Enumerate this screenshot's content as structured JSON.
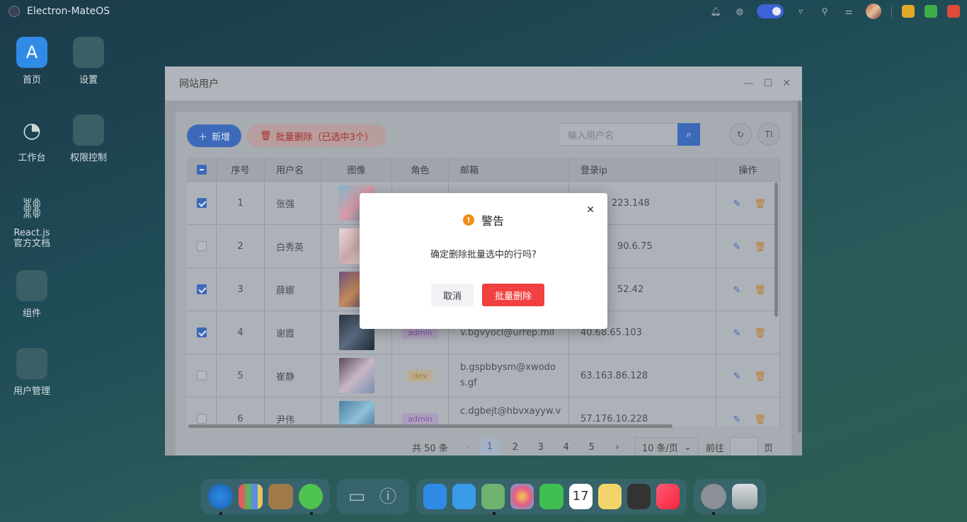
{
  "app": {
    "title": "Electron-MateOS"
  },
  "desktop": [
    {
      "label": "首页",
      "icon": "app-store-icon"
    },
    {
      "label": "设置",
      "icon": "settings-folder-icon"
    },
    {
      "label": "工作台",
      "icon": "dashboard-gauge-icon"
    },
    {
      "label": "权限控制",
      "icon": "permission-folder-icon"
    },
    {
      "label": "React.js官方文档",
      "icon": "link-icon"
    },
    {
      "label": "组件",
      "icon": "components-folder-icon"
    },
    {
      "label": "用户管理",
      "icon": "users-folder-icon"
    }
  ],
  "window": {
    "title": "网站用户",
    "add_label": "新增",
    "batch_delete_label": "批量删除（已选中3个）",
    "search_placeholder": "输入用户名",
    "columns": [
      "序号",
      "用户名",
      "图像",
      "角色",
      "邮箱",
      "登录ip",
      "操作"
    ],
    "rows": [
      {
        "no": "1",
        "name": "张强",
        "role": "",
        "email": "",
        "ip": "223.148",
        "checked": true
      },
      {
        "no": "2",
        "name": "白秀英",
        "role": "",
        "email": "",
        "ip": "90.6.75",
        "checked": false
      },
      {
        "no": "3",
        "name": "薛娜",
        "role": "",
        "email": "",
        "ip": "52.42",
        "checked": true
      },
      {
        "no": "4",
        "name": "谢霞",
        "role": "admin",
        "email": "v.bgvyocl@urrep.mil",
        "ip": "40.68.65.103",
        "checked": true
      },
      {
        "no": "5",
        "name": "崔静",
        "role": "dev",
        "email": "b.gspbbysm@xwodos.gf",
        "ip": "63.163.86.128",
        "checked": false
      },
      {
        "no": "6",
        "name": "尹伟",
        "role": "admin",
        "email": "c.dgbejt@hbvxayyw.v",
        "ip": "57.176.10.228",
        "checked": false
      }
    ],
    "pagination": {
      "total": "共 50 条",
      "pages": [
        "1",
        "2",
        "3",
        "4",
        "5"
      ],
      "current": "1",
      "page_size": "10 条/页",
      "goto": "前往",
      "page_unit": "页"
    }
  },
  "dialog": {
    "title": "警告",
    "message": "确定删除批量选中的行吗?",
    "cancel": "取消",
    "confirm": "批量删除"
  },
  "calendar": {
    "month": "JUL",
    "day": "17"
  }
}
